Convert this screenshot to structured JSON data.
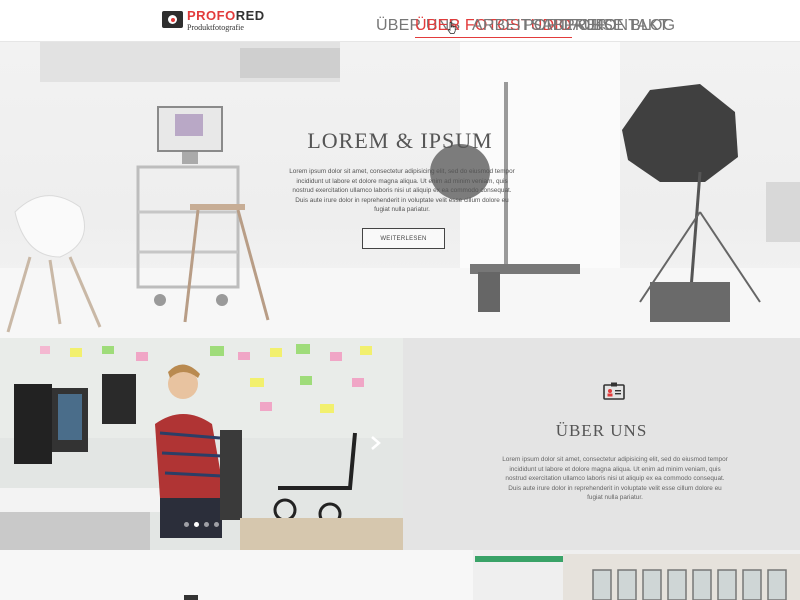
{
  "logo": {
    "brand_red": "PROFO",
    "brand_dark": "RED",
    "subtitle": "Produktfotografie"
  },
  "nav": [
    {
      "label": "ÜBER UNS",
      "active": false
    },
    {
      "label": "ÜBER FOTOSTUDIO",
      "active": true
    },
    {
      "label": "ARBEITSABLAUF",
      "active": false
    },
    {
      "label": "PORTFOLIO",
      "active": false
    },
    {
      "label": "PREISE",
      "active": false
    },
    {
      "label": "KONTAKT",
      "active": false
    },
    {
      "label": "BLOG",
      "active": false
    }
  ],
  "hero": {
    "title": "LOREM & IPSUM",
    "text": "Lorem ipsum dolor sit amet, consectetur adipisicing elit, sed do eiusmod tempor incididunt ut labore et dolore magna aliqua. Ut enim ad minim veniam, quis nostrud exercitation ullamco laboris nisi ut aliquip ex ea commodo consequat. Duis aute irure dolor in reprehenderit in voluptate velit esse cillum dolore eu fugiat nulla pariatur.",
    "button": "WEITERLESEN"
  },
  "about": {
    "title": "ÜBER UNS",
    "text": "Lorem ipsum dolor sit amet, consectetur adipisicing elit, sed do eiusmod tempor incididunt ut labore et dolore magna aliqua. Ut enim ad minim veniam, quis nostrud exercitation ullamco laboris nisi ut aliquip ex ea commodo consequat. Duis aute irure dolor in reprehenderit in voluptate velit esse cillum dolore eu fugiat nulla pariatur."
  },
  "slider": {
    "total": 4,
    "current": 2
  },
  "colors": {
    "accent": "#e23b3b",
    "dark": "#333333",
    "panel": "#e4e4e4"
  },
  "icons": {
    "logo": "camera-icon",
    "about": "id-card-icon",
    "slider_next": "chevron-right-icon",
    "cursor": "hand-pointer-icon"
  }
}
